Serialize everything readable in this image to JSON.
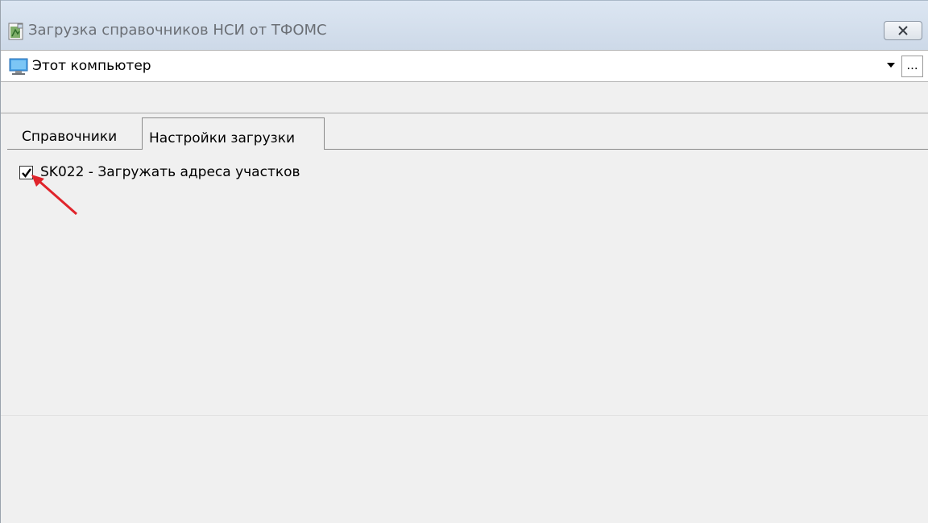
{
  "window": {
    "title": "Загрузка справочников НСИ от ТФОМС",
    "close_icon": "close-icon"
  },
  "location": {
    "value": "Этот компьютер",
    "icon": "computer-icon",
    "browse_label": "..."
  },
  "tabs": [
    {
      "label": "Справочники",
      "active": false
    },
    {
      "label": "Настройки загрузки",
      "active": true
    }
  ],
  "settings": {
    "options": [
      {
        "label": "SK022 - Загружать адреса участков",
        "checked": true
      }
    ]
  },
  "annotation": {
    "color": "#e0242b"
  }
}
